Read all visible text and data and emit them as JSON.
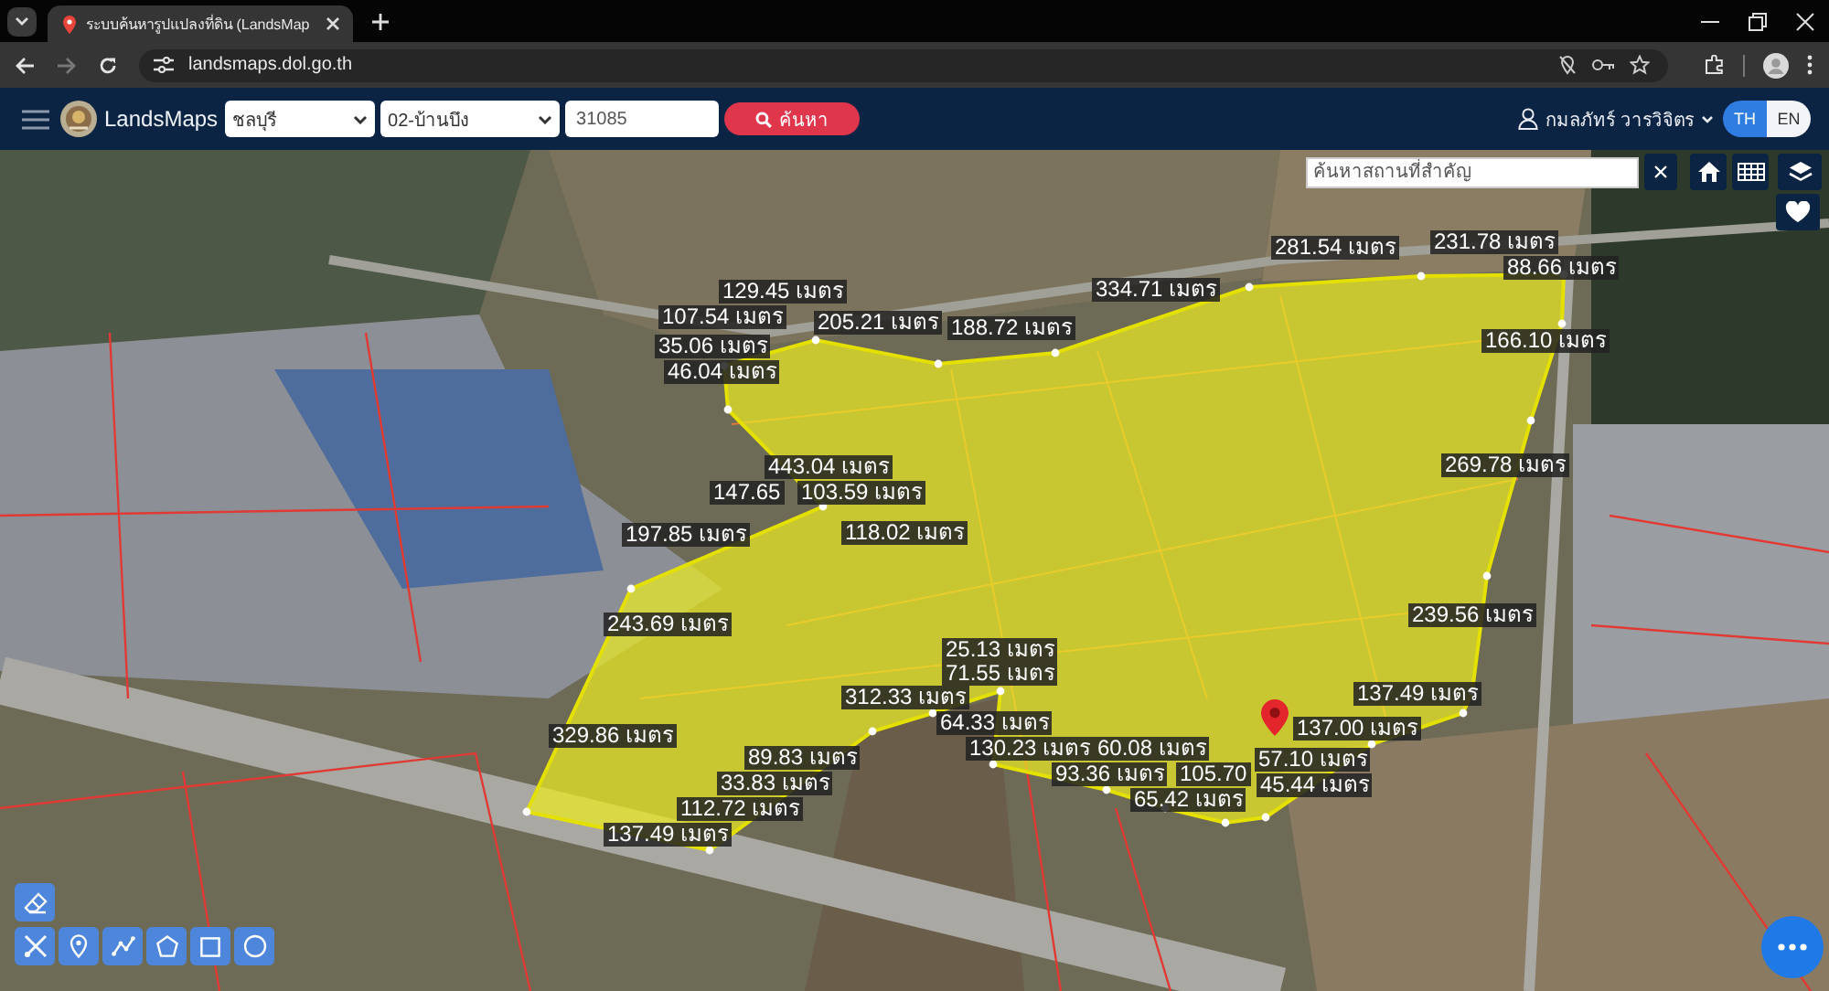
{
  "browser": {
    "tab": {
      "title": "ระบบค้นหารูปแปลงที่ดิน (LandsMap"
    },
    "forward_disabled": true,
    "address": "landsmaps.dol.go.th"
  },
  "header": {
    "app_name": "LandsMaps",
    "province": "ชลบุรี",
    "district": "02-บ้านบึง",
    "parcel_number": "31085",
    "search_button": "ค้นหา",
    "user_name": "กมลภัทร์ วารวิจิตร",
    "languages": [
      {
        "label": "TH",
        "selected": true
      },
      {
        "label": "EN",
        "selected": false
      }
    ]
  },
  "map": {
    "place_search": {
      "placeholder": "ค้นหาสถานที่สำคัญ"
    },
    "measurements": [
      "231.78 เมตร",
      "281.54 เมตร",
      "88.66 เมตร",
      "334.71 เมตร",
      "129.45 เมตร",
      "107.54 เมตร",
      "205.21 เมตร",
      "188.72 เมตร",
      "166.10 เมตร",
      "35.06 เมตร",
      "46.04 เมตร",
      "269.78 เมตร",
      "443.04 เมตร",
      "147.65",
      "103.59 เมตร",
      "197.85 เมตร",
      "118.02 เมตร",
      "239.56 เมตร",
      "243.69 เมตร",
      "25.13 เมตร",
      "71.55 เมตร",
      "137.49 เมตร",
      "312.33 เมตร",
      "64.33 เมตร",
      "137.00 เมตร",
      "329.86 เมตร",
      "130.23 เมตร",
      "60.08 เมตร",
      "89.83 เมตร",
      "57.10 เมตร",
      "93.36 เมตร",
      "105.70",
      "33.83 เมตร",
      "45.44 เมตร",
      "65.42 เมตร",
      "112.72 เมตร",
      "137.49 เมตร"
    ]
  }
}
